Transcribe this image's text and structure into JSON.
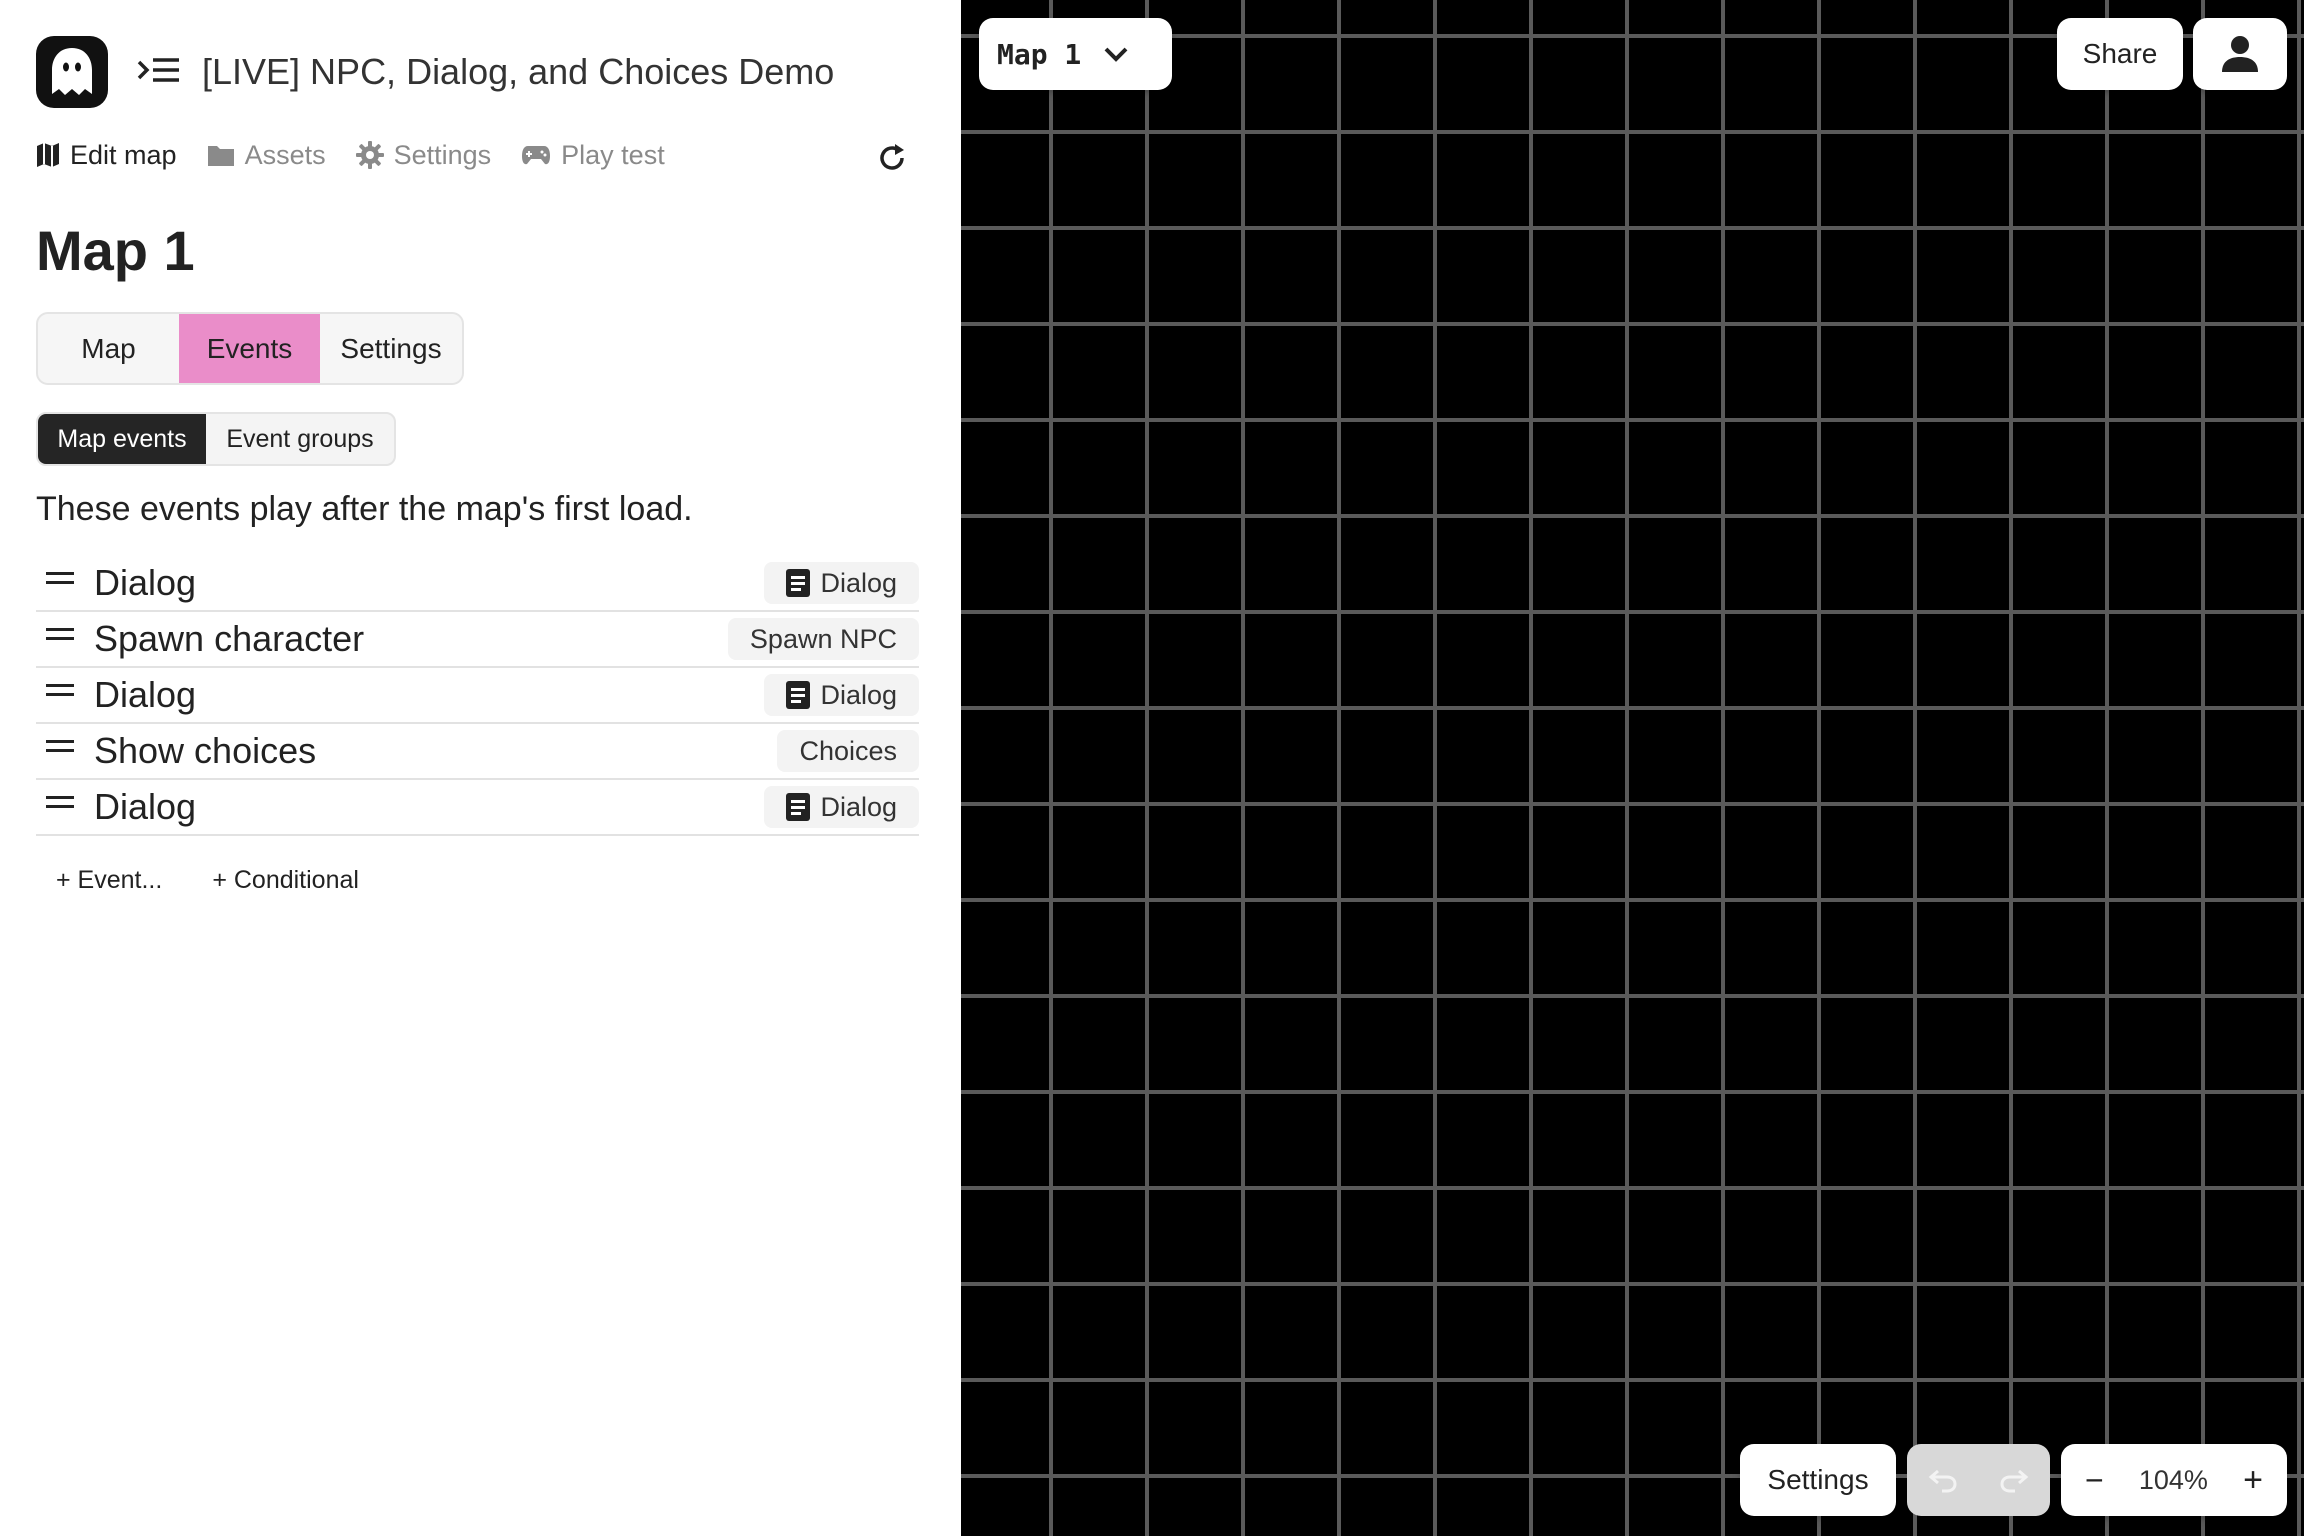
{
  "header": {
    "project_title": "[LIVE] NPC, Dialog, and Choices Demo",
    "logo_icon": "ghost-icon",
    "menu_icon": "menu-indent-icon"
  },
  "nav": {
    "items": [
      {
        "label": "Edit map",
        "icon": "map-icon",
        "active": true
      },
      {
        "label": "Assets",
        "icon": "folder-icon",
        "active": false
      },
      {
        "label": "Settings",
        "icon": "gear-icon",
        "active": false
      },
      {
        "label": "Play test",
        "icon": "gamepad-icon",
        "active": false
      }
    ],
    "refresh_icon": "refresh-icon"
  },
  "map_title": "Map 1",
  "tabs": [
    {
      "label": "Map",
      "active": false
    },
    {
      "label": "Events",
      "active": true
    },
    {
      "label": "Settings",
      "active": false
    }
  ],
  "subtabs": [
    {
      "label": "Map events",
      "active": true
    },
    {
      "label": "Event groups",
      "active": false
    }
  ],
  "description": "These events play after the map's first load.",
  "events": [
    {
      "name": "Dialog",
      "badge": "Dialog",
      "badge_icon": "document-icon"
    },
    {
      "name": "Spawn character",
      "badge": "Spawn NPC",
      "badge_icon": ""
    },
    {
      "name": "Dialog",
      "badge": "Dialog",
      "badge_icon": "document-icon"
    },
    {
      "name": "Show choices",
      "badge": "Choices",
      "badge_icon": ""
    },
    {
      "name": "Dialog",
      "badge": "Dialog",
      "badge_icon": "document-icon"
    }
  ],
  "add_actions": {
    "event_label": "+ Event...",
    "conditional_label": "+ Conditional"
  },
  "canvas": {
    "map_selector_label": "Map 1",
    "share_label": "Share",
    "settings_label": "Settings",
    "zoom_level": "104%",
    "zoom_out_label": "−",
    "zoom_in_label": "+",
    "background_color": "#000000",
    "grid_color": "#5a5a5a"
  },
  "colors": {
    "accent_pink": "#ea8dc9",
    "dark": "#252525"
  }
}
